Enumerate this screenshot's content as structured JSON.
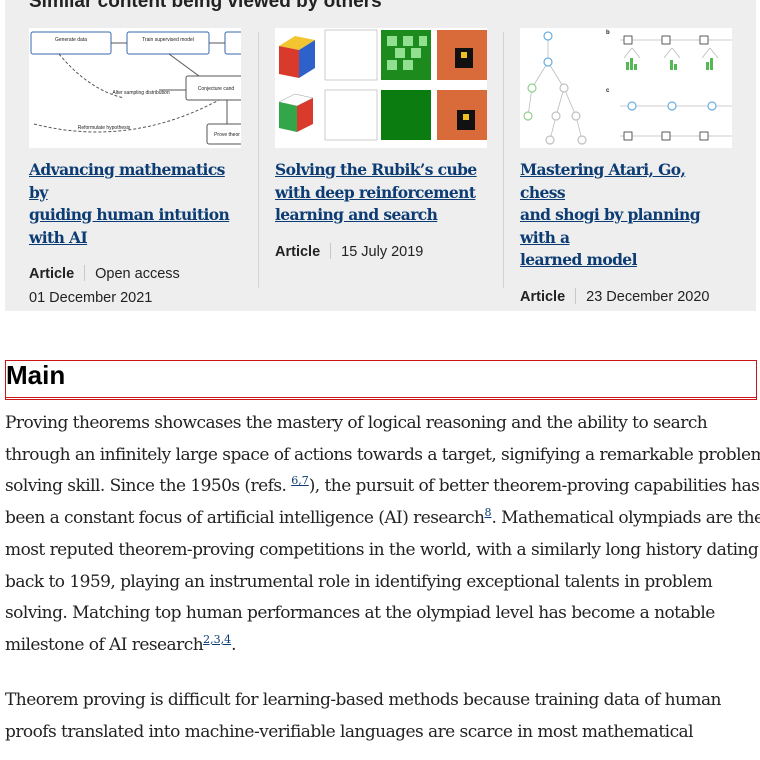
{
  "related": {
    "heading": "Similar content being viewed by others",
    "cards": [
      {
        "title_lines": [
          "Advancing mathematics by",
          "guiding human intuition",
          "with AI"
        ],
        "type": "Article",
        "access": "Open access",
        "date": "01 December 2021",
        "thumb_labels": [
          "Generate data",
          "Train supervised model",
          "Alter sampling distribution",
          "Conjecture cand",
          "Reformulate hypothesis",
          "Prove theor"
        ]
      },
      {
        "title_lines": [
          "Solving the Rubik’s cube",
          "with deep reinforcement",
          "learning and search"
        ],
        "type": "Article",
        "date": "15 July 2019"
      },
      {
        "title_lines": [
          "Mastering Atari, Go, chess",
          "and shogi by planning with a",
          "learned model"
        ],
        "type": "Article",
        "date": "23 December 2020"
      }
    ]
  },
  "section": {
    "title": "Main"
  },
  "paragraph1": {
    "lines": [
      "Proving theorems showcases the mastery of logical reasoning and the ability to search",
      "through an infinitely large space of actions towards a target, signifying a remarkable problem-",
      "solving skill. Since the 1950s (refs. ",
      "), the pursuit of better theorem-proving capabilities has",
      "been a constant focus of artificial intelligence (AI) research",
      ". Mathematical olympiads are the",
      "most reputed theorem-proving competitions in the world, with a similarly long history dating",
      "back to 1959, playing an instrumental role in identifying exceptional talents in problem",
      "solving. Matching top human performances at the olympiad level has become a notable",
      "milestone of AI research",
      "."
    ],
    "refs": {
      "r67": "6,7",
      "r8": "8",
      "r234": "2,3,4"
    }
  },
  "paragraph2": {
    "lines": [
      "Theorem proving is difficult for learning-based methods because training data of human",
      "proofs translated into machine-verifiable languages are scarce in most mathematical"
    ]
  },
  "colors": {
    "link": "#0c3c73",
    "panel": "#eeeeee",
    "highlight": "#c91515"
  }
}
